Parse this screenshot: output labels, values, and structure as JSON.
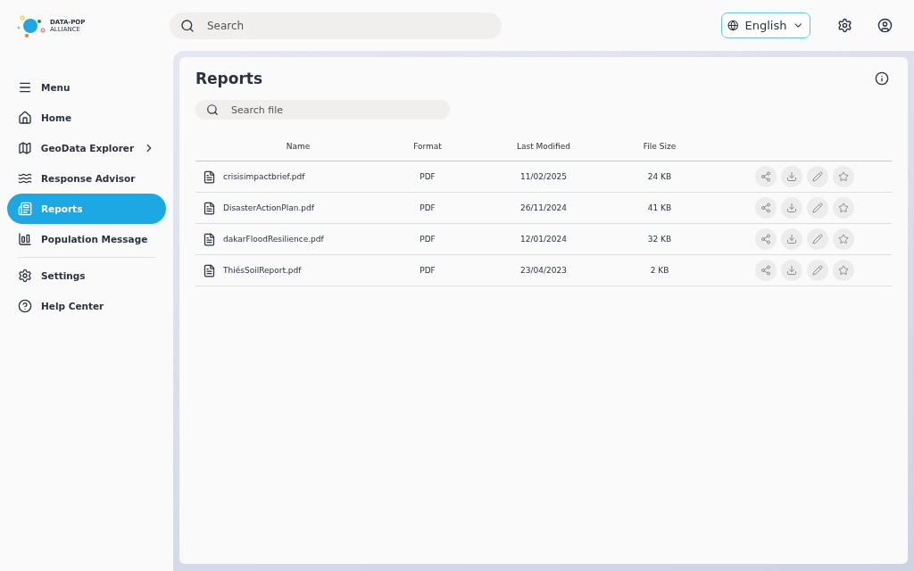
{
  "logo": {
    "line1": "DATA-POP",
    "line2": "ALLIANCE"
  },
  "search": {
    "placeholder": "Search"
  },
  "language": {
    "value": "English"
  },
  "nav": {
    "items": [
      {
        "label": "Menu",
        "selected": false
      },
      {
        "label": "Home",
        "selected": false
      },
      {
        "label": "GeoData Explorer",
        "selected": false
      },
      {
        "label": "Response Advisor",
        "selected": false
      },
      {
        "label": "Reports",
        "selected": true
      },
      {
        "label": "Population Message",
        "selected": false
      }
    ],
    "footer_items": [
      {
        "label": "Settings",
        "selected": false
      },
      {
        "label": "Help Center",
        "selected": false
      }
    ]
  },
  "page": {
    "title": "Reports",
    "file_search": {
      "placeholder": "Search file"
    }
  },
  "table": {
    "columns": [
      "Name",
      "Format",
      "Last Modified",
      "File Size"
    ],
    "rows": [
      {
        "name": "crisisimpactbrief.pdf",
        "format": "PDF",
        "modified": "11/02/2025",
        "size": "24 KB"
      },
      {
        "name": "DisasterActionPlan.pdf",
        "format": "PDF",
        "modified": "26/11/2024",
        "size": "41 KB"
      },
      {
        "name": "dakarFloodResilience.pdf",
        "format": "PDF",
        "modified": "12/01/2024",
        "size": "32 KB"
      },
      {
        "name": "ThiésSoilReport.pdf",
        "format": "PDF",
        "modified": "23/04/2023",
        "size": "2 KB"
      }
    ]
  }
}
